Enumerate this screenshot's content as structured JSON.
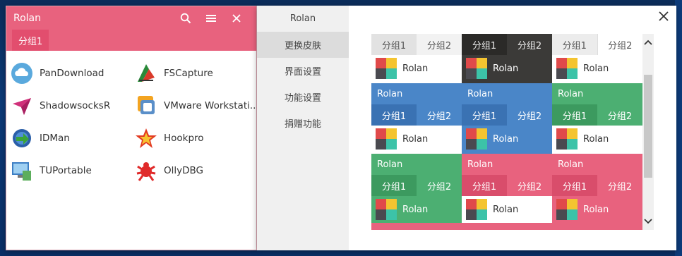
{
  "launcher": {
    "title": "Rolan",
    "tab": "分组1",
    "apps": [
      {
        "label": "PanDownload",
        "icon": "cloud-icon"
      },
      {
        "label": "FSCapture",
        "icon": "fscapture-icon"
      },
      {
        "label": "ShadowsocksR",
        "icon": "paper-plane-icon"
      },
      {
        "label": "VMware Workstati...",
        "icon": "vmware-icon"
      },
      {
        "label": "IDMan",
        "icon": "idm-icon"
      },
      {
        "label": "Hookpro",
        "icon": "star-icon"
      },
      {
        "label": "TUPortable",
        "icon": "monitor-icon"
      },
      {
        "label": "OllyDBG",
        "icon": "bug-icon"
      }
    ]
  },
  "settings": {
    "nav": [
      "Rolan",
      "更换皮肤",
      "界面设置",
      "功能设置",
      "捐赠功能"
    ],
    "active_index": 1,
    "skins": {
      "group1": "分组1",
      "group2": "分组2",
      "app_label": "Rolan",
      "header_title": "Rolan"
    }
  },
  "colors": {
    "pink": "#e8627e",
    "blue": "#4a86c8",
    "green": "#4caf72",
    "dark": "#3b3a38"
  }
}
